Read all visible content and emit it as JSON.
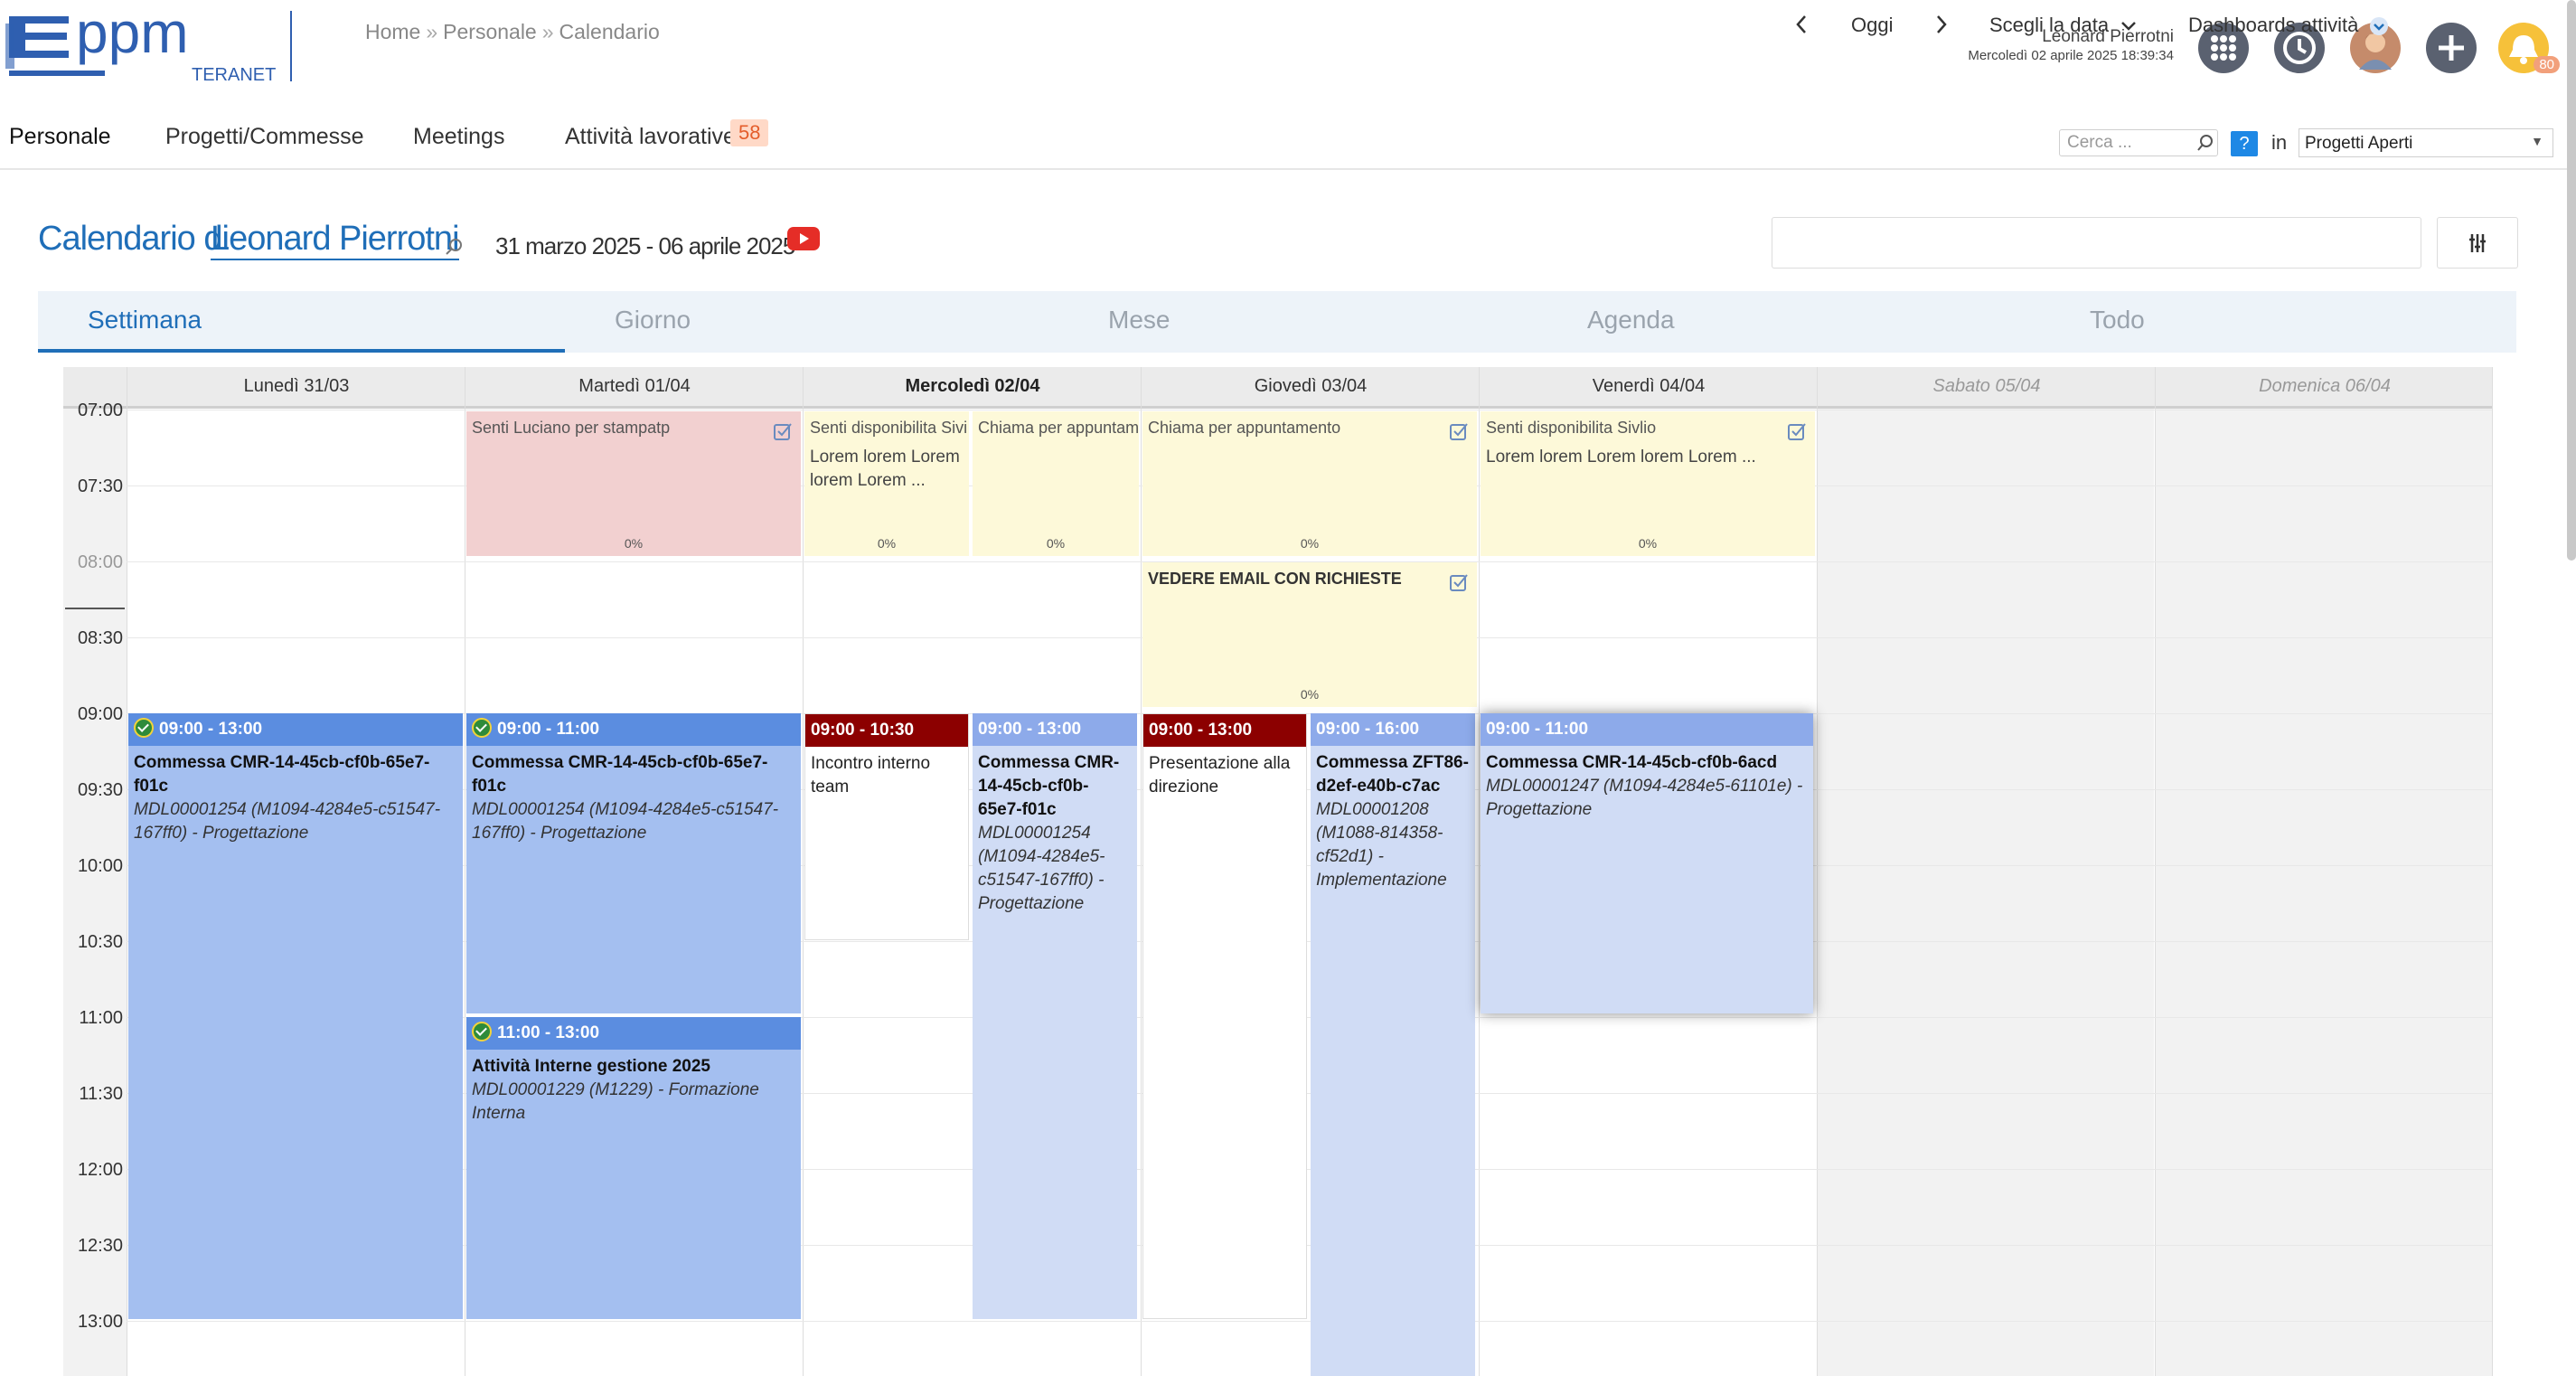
{
  "app": {
    "logo_text": "ppm",
    "logo_sub": "TERANET"
  },
  "breadcrumb": [
    "Home",
    "Personale",
    "Calendario"
  ],
  "user": {
    "name": "Leonard Pierrotni",
    "datetime": "Mercoledì 02 aprile 2025 18:39:34"
  },
  "header_icons": [
    "apps-grid-icon",
    "clock-icon",
    "avatar",
    "add-icon",
    "bell-icon"
  ],
  "notifications": {
    "count": "80"
  },
  "nav": {
    "items": [
      "Personale",
      "Progetti/Commesse",
      "Meetings",
      "Attività lavorative"
    ],
    "badge": "58"
  },
  "search": {
    "placeholder": "Cerca ...",
    "help": "?",
    "in_label": "in",
    "scope": "Progetti Aperti"
  },
  "calendar": {
    "title": "Calendario di",
    "owner": "Leonard Pierrotni",
    "range": "31 marzo 2025 - 06 aprile 2025",
    "toolbar": {
      "today": "Oggi",
      "pick_date": "Scegli la data",
      "dashboards": "Dashboards attività"
    },
    "tabs": [
      "Settimana",
      "Giorno",
      "Mese",
      "Agenda",
      "Todo"
    ],
    "days": [
      "Lunedì 31/03",
      "Martedì 01/04",
      "Mercoledì 02/04",
      "Giovedì 03/04",
      "Venerdì 04/04",
      "Sabato 05/04",
      "Domenica 06/04"
    ],
    "times": [
      "07:00",
      "07:30",
      "08:00",
      "08:30",
      "09:00",
      "09:30",
      "10:00",
      "10:30",
      "11:00",
      "11:30",
      "12:00",
      "12:30",
      "13:00"
    ],
    "tasks": [
      {
        "title": "Senti Luciano per stampatp",
        "desc": "",
        "pct": "0%"
      },
      {
        "title": "Senti disponibilita Sivi",
        "desc": "Lorem lorem Lorem lorem Lorem ...",
        "pct": "0%"
      },
      {
        "title": "Chiama per appuntam",
        "desc": "",
        "pct": "0%"
      },
      {
        "title": "Chiama per appuntamento",
        "desc": "",
        "pct": "0%"
      },
      {
        "title": "Senti disponibilita Sivlio",
        "desc": "Lorem lorem Lorem lorem Lorem ...",
        "pct": "0%"
      },
      {
        "title": "VEDERE EMAIL CON RICHIESTE",
        "desc": "",
        "pct": "0%"
      }
    ],
    "events": [
      {
        "time": "09:00 - 13:00",
        "title": "Commessa CMR-14-45cb-cf0b-65e7-f01c",
        "detail": "MDL00001254 (M1094-4284e5-c51547-167ff0) - Progettazione"
      },
      {
        "time": "09:00 - 11:00",
        "title": "Commessa CMR-14-45cb-cf0b-65e7-f01c",
        "detail": "MDL00001254 (M1094-4284e5-c51547-167ff0) - Progettazione"
      },
      {
        "time": "11:00 - 13:00",
        "title": "Attività Interne gestione 2025",
        "detail": "MDL00001229 (M1229) - Formazione Interna"
      },
      {
        "time": "09:00 - 10:30",
        "title": "Incontro interno team",
        "detail": ""
      },
      {
        "time": "09:00 - 13:00",
        "title": "Commessa CMR-14-45cb-cf0b-65e7-f01c",
        "detail": "MDL00001254 (M1094-4284e5-c51547-167ff0) - Progettazione"
      },
      {
        "time": "09:00 - 13:00",
        "title": "Presentazione alla direzione",
        "detail": ""
      },
      {
        "time": "09:00 - 16:00",
        "title": "Commessa ZFT86-d2ef-e40b-c7ac",
        "detail": "MDL00001208 (M1088-814358-cf52d1) - Implementazione"
      },
      {
        "time": "09:00 - 11:00",
        "title": "Commessa CMR-14-45cb-cf0b-6acd",
        "detail": "MDL00001247 (M1094-4284e5-61101e) - Progettazione"
      }
    ]
  },
  "colors": {
    "accent": "#1f6eb8",
    "event_blue": "#a4bff0",
    "event_dark": "#8c0000",
    "task_yellow": "#fdf9d9",
    "task_pink": "#f2d0d0"
  }
}
